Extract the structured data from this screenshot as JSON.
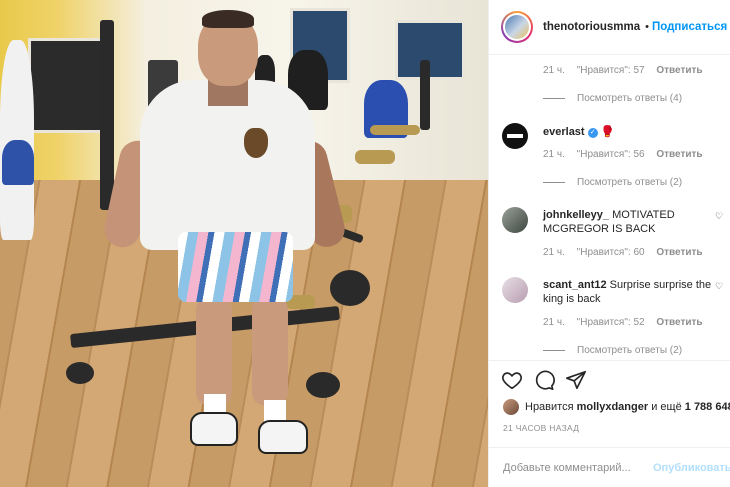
{
  "header": {
    "username": "thenotoriousmma",
    "separator": "•",
    "follow_label": "Подписаться"
  },
  "comments": [
    {
      "username": "",
      "text": "",
      "time": "21 ч.",
      "likes": "\"Нравится\": 57",
      "reply": "Ответить",
      "view_replies": "Посмотреть ответы (4)"
    },
    {
      "username": "everlast",
      "text": "",
      "emoji": "🥊",
      "time": "21 ч.",
      "likes": "\"Нравится\": 56",
      "reply": "Ответить",
      "view_replies": "Посмотреть ответы (2)"
    },
    {
      "username": "johnkelleyy_",
      "text": "MOTIVATED MCGREGOR IS BACK",
      "time": "21 ч.",
      "likes": "\"Нравится\": 60",
      "reply": "Ответить",
      "view_replies": ""
    },
    {
      "username": "scant_ant12",
      "text": "Surprise surprise the king is back",
      "time": "21 ч.",
      "likes": "\"Нравится\": 52",
      "reply": "Ответить",
      "view_replies": "Посмотреть ответы (2)"
    }
  ],
  "likes": {
    "prefix": "Нравится",
    "user": "mollyxdanger",
    "suffix": "и ещё",
    "count": "1 788 648"
  },
  "time_ago": "21 ЧАСОВ НАЗАД",
  "add_comment": {
    "placeholder": "Добавьте комментарий...",
    "publish_label": "Опубликовать"
  },
  "colors": {
    "link_blue": "#0095f6",
    "publish_disabled": "#b2dffc",
    "muted": "#8e8e8e",
    "text": "#262626"
  }
}
